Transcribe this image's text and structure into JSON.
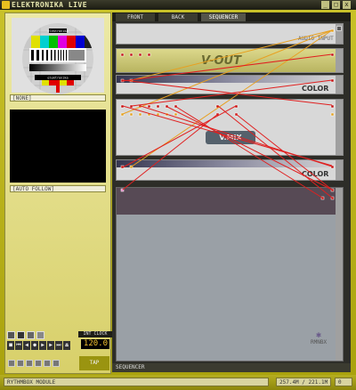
{
  "window": {
    "title": "ELEKTRONIKA LIVE",
    "buttons": [
      "_",
      "□",
      "x"
    ]
  },
  "left_panel": {
    "preview_label": "[NONE]",
    "testcard_text": [
      "elektronika",
      "elektronika"
    ],
    "auto_follow_label": "[AUTO FOLLOW]",
    "clock_label": "INT CLOCK",
    "bpm": "120.0",
    "tap_label": "TAP"
  },
  "tabs": [
    {
      "label": "FRONT"
    },
    {
      "label": "BACK"
    },
    {
      "label": "SEQUENCER"
    }
  ],
  "modules": {
    "audio_input": "AUDIO INPUT",
    "vout": "V-OUT",
    "color1": "COLOR",
    "vmix": "V.MIX",
    "color2": "COLOR",
    "rmnbx": "RMNBX"
  },
  "bottom_tab": "SEQUENCER",
  "status": {
    "left": "RYTHMBOX MODULE",
    "mem": "257.4M / 221.1M",
    "count": "0"
  },
  "colors": {
    "accent": "#c9c22a",
    "cable_red": "#e02020",
    "cable_orange": "#e8a020"
  }
}
